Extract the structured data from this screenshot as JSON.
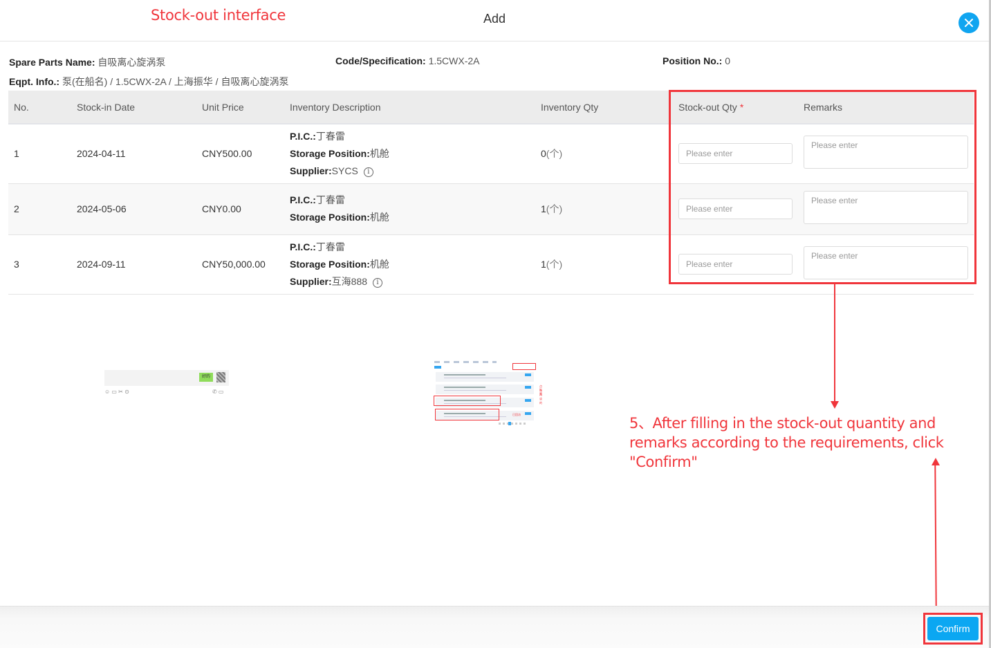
{
  "annotations": {
    "title": "Stock-out interface",
    "step": "5、After filling in the stock-out quantity and remarks according to the requirements, click \"Confirm\"",
    "color": "#f0353b"
  },
  "dialog": {
    "title": "Add",
    "close_icon": "close-icon",
    "confirm_label": "Confirm",
    "accent_color": "#0ba7f2"
  },
  "info": {
    "spare_parts_name_label": "Spare Parts Name:",
    "spare_parts_name": "自吸离心旋涡泵",
    "code_label": "Code/Specification:",
    "code": "1.5CWX-2A",
    "position_label": "Position No.:",
    "position": "0",
    "eqpt_label": "Eqpt. Info.:",
    "eqpt": "泵(在船名) / 1.5CWX-2A / 上海振华 / 自吸离心旋涡泵"
  },
  "table": {
    "columns": [
      "No.",
      "Stock-in Date",
      "Unit Price",
      "Inventory Description",
      "Inventory Qty",
      "Stock-out Qty",
      "Remarks"
    ],
    "required_mark": "*",
    "desc_labels": {
      "pic": "P.I.C.:",
      "storage": "Storage Position:",
      "supplier": "Supplier:"
    },
    "rows": [
      {
        "no": "1",
        "date": "2024-04-11",
        "price": "CNY500.00",
        "pic": "丁春雷",
        "storage": "机舱",
        "supplier": "SYCS",
        "qty": "0",
        "unit": "(个)",
        "stockout_placeholder": "Please enter",
        "remarks_placeholder": "Please enter"
      },
      {
        "no": "2",
        "date": "2024-05-06",
        "price": "CNY0.00",
        "pic": "丁春雷",
        "storage": "机舱",
        "qty": "1",
        "unit": "(个)",
        "stockout_placeholder": "Please enter",
        "remarks_placeholder": "Please enter"
      },
      {
        "no": "3",
        "date": "2024-09-11",
        "price": "CNY50,000.00",
        "pic": "丁春雷",
        "storage": "机舱",
        "supplier": "互海888",
        "qty": "1",
        "unit": "(个)",
        "stockout_placeholder": "Please enter",
        "remarks_placeholder": "Please enter"
      }
    ],
    "info_icon": "info-circle-icon",
    "info_glyph": "i"
  },
  "thumbnails": {
    "chat_button": "好的",
    "chat_icons_left": "☺ ▭ ✂ ⊙",
    "chat_icons_right": "✆ ▭",
    "screen_note_1": "点击再谈的",
    "screen_note_2": "标签",
    "screen_note_3": "已回访"
  }
}
